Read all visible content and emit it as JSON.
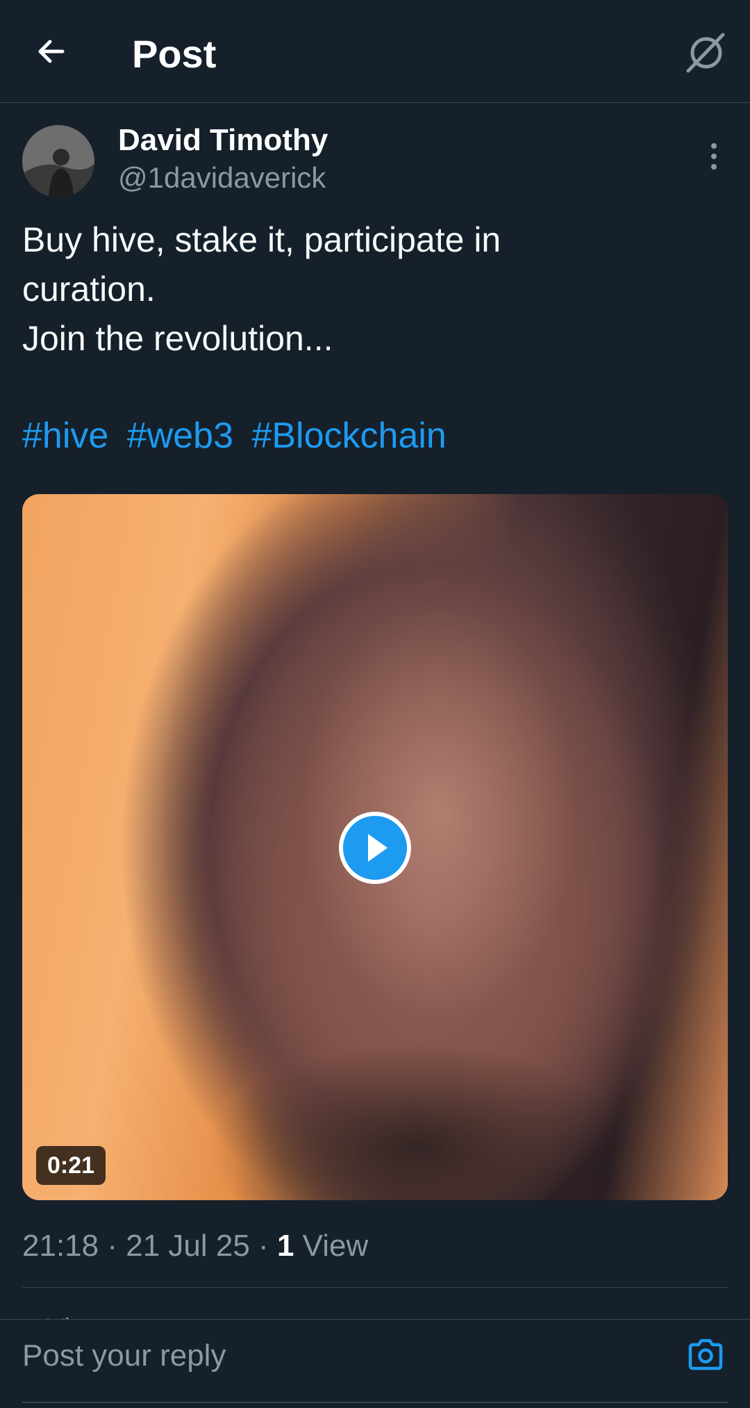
{
  "header": {
    "title": "Post",
    "back_icon": "arrow-left-icon",
    "grok_icon": "grok-icon"
  },
  "post": {
    "author": {
      "display_name": "David Timothy",
      "handle": "@1davidaverick",
      "avatar": "avatar"
    },
    "text_lines": [
      "Buy hive, stake it, participate in",
      "curation.",
      "Join the revolution..."
    ],
    "hashtags": [
      "#hive",
      "#web3",
      "#Blockchain"
    ],
    "video": {
      "duration": "0:21",
      "play_icon": "play-icon"
    },
    "meta": {
      "time": "21:18",
      "date": "21 Jul 25",
      "views_count": "1",
      "views_label": "View",
      "separator": "·"
    }
  },
  "next_item_peek": "+ View quote posts",
  "reply_bar": {
    "placeholder": "Post your reply",
    "camera_icon": "camera-icon"
  },
  "colors": {
    "background": "#15202b",
    "accent": "#1d9bf0",
    "secondary_text": "#8b98a5",
    "divider": "#38444d"
  }
}
